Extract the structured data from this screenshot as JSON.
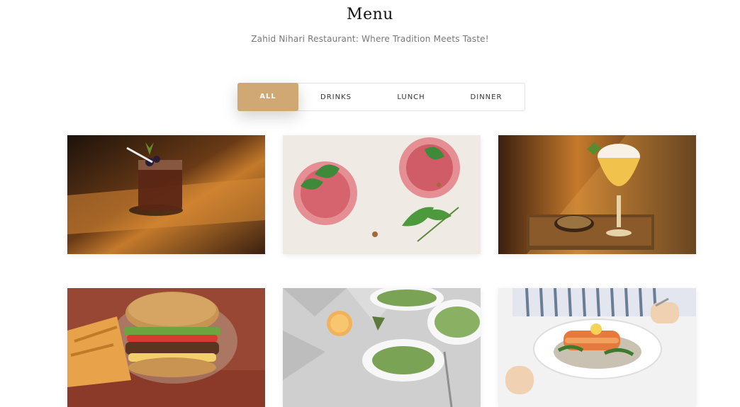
{
  "header": {
    "title": "Menu",
    "subtitle": "Zahid Nihari Restaurant: Where Tradition Meets Taste!"
  },
  "filters": {
    "tabs": [
      {
        "label": "ALL",
        "active": true
      },
      {
        "label": "DRINKS",
        "active": false
      },
      {
        "label": "LUNCH",
        "active": false
      },
      {
        "label": "DINNER",
        "active": false
      }
    ]
  },
  "colors": {
    "accent": "#d0a873"
  },
  "gallery": {
    "items": [
      {
        "name": "cocktail-on-wooden-table-image"
      },
      {
        "name": "pink-drinks-with-mint-image"
      },
      {
        "name": "beer-glass-with-snack-tray-image"
      },
      {
        "name": "burger-with-fries-image"
      },
      {
        "name": "salad-plates-image"
      },
      {
        "name": "salmon-plate-image"
      }
    ]
  }
}
